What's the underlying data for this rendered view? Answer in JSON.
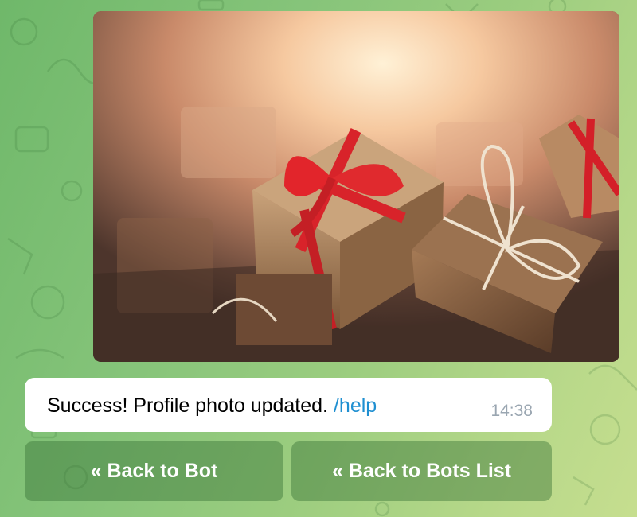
{
  "message": {
    "text": "Success! Profile photo updated.",
    "command": "/help",
    "time": "14:38",
    "image_subject": "gift-boxes-photo"
  },
  "keyboard": {
    "buttons": [
      {
        "label": "« Back to Bot"
      },
      {
        "label": "« Back to Bots List"
      }
    ]
  },
  "colors": {
    "background_start": "#6fb86a",
    "background_end": "#c6de8f",
    "link": "#1f8fd1",
    "timestamp": "#9aa6b1"
  }
}
